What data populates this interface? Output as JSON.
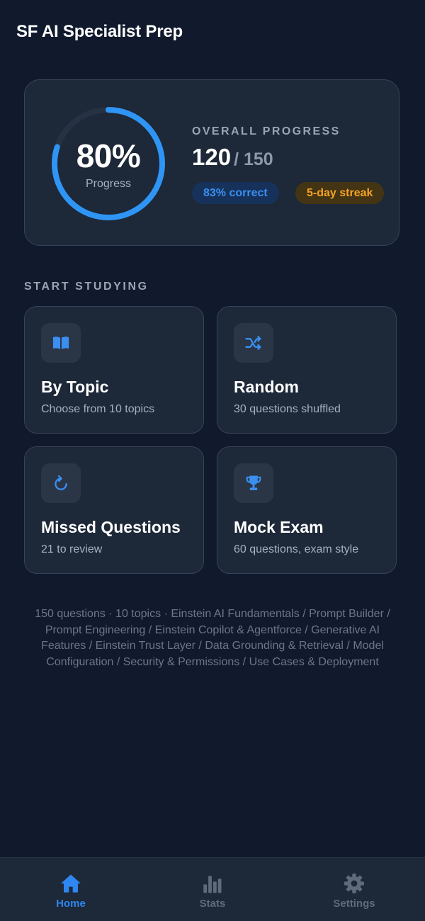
{
  "app": {
    "title": "SF AI Specialist Prep"
  },
  "progress": {
    "percent_text": "80%",
    "percent_value": 0.8,
    "ring_label": "Progress",
    "overall_label": "OVERALL PROGRESS",
    "answered": "120",
    "total": "/ 150",
    "correct_badge": "83% correct",
    "streak_badge": "5-day streak"
  },
  "study": {
    "section_label": "START STUDYING",
    "tiles": [
      {
        "title": "By Topic",
        "subtitle": "Choose from 10 topics",
        "icon": "book-icon"
      },
      {
        "title": "Random",
        "subtitle": "30 questions shuffled",
        "icon": "shuffle-icon"
      },
      {
        "title": "Missed Questions",
        "subtitle": "21 to review",
        "icon": "refresh-icon"
      },
      {
        "title": "Mock Exam",
        "subtitle": "60 questions, exam style",
        "icon": "trophy-icon"
      }
    ]
  },
  "footnote": "150 questions · 10 topics · Einstein AI Fundamentals / Prompt Builder / Prompt Engineering / Einstein Copilot & Agentforce / Generative AI Features / Einstein Trust Layer / Data Grounding & Retrieval / Model Configuration / Security & Permissions / Use Cases & Deployment",
  "tabs": [
    {
      "label": "Home",
      "icon": "home-icon",
      "active": true
    },
    {
      "label": "Stats",
      "icon": "bar-chart-icon",
      "active": false
    },
    {
      "label": "Settings",
      "icon": "gear-icon",
      "active": false
    }
  ],
  "colors": {
    "background": "#101a2c",
    "card": "#1d2838",
    "accent_blue": "#2f86f0",
    "accent_orange": "#f5a327",
    "ring_track": "#263244"
  }
}
